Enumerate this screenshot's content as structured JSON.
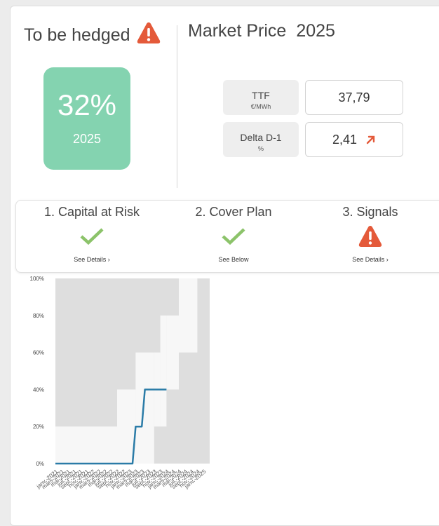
{
  "hedge": {
    "title": "To be hedged",
    "percent": "32%",
    "year": "2025"
  },
  "market": {
    "title": "Market Price",
    "year": "2025",
    "rows": [
      {
        "label": "TTF",
        "unit": "€/MWh",
        "value": "37,79"
      },
      {
        "label": "Delta D-1",
        "unit": "%",
        "value": "2,41",
        "trend": "up"
      }
    ]
  },
  "steps": [
    {
      "title": "1. Capital at Risk",
      "status": "ok",
      "link": "See Details",
      "chevron": "›"
    },
    {
      "title": "2. Cover Plan",
      "status": "ok",
      "link": "See Below"
    },
    {
      "title": "3. Signals",
      "status": "warning",
      "link": "See Details",
      "chevron": "›"
    }
  ],
  "colors": {
    "accent_green": "#84d3b0",
    "check_green": "#8cc36a",
    "warning_red": "#e45a3a",
    "line_blue": "#2a7ba7",
    "band_dark": "#dedede",
    "band_light": "#f7f7f7"
  },
  "chart_data": {
    "type": "area",
    "x": [
      "janv.-2021",
      "mars-2021",
      "mai-2021",
      "juil.-2021",
      "sept.-2021",
      "nov.-2021",
      "janv.-2022",
      "mars-2022",
      "mai-2022",
      "juil.-2022",
      "sept.-2022",
      "nov.-2022",
      "janv.-2023",
      "mars-2023",
      "mai-2023",
      "juil.-2023",
      "sept.-2023",
      "nov.-2023",
      "janv.-2024",
      "mars-2024",
      "mai-2024",
      "juil.-2024",
      "sept.-2024",
      "nov.-2024",
      "janv.-2025"
    ],
    "yticks": [
      "0%",
      "20%",
      "40%",
      "60%",
      "80%",
      "100%"
    ],
    "ylim": [
      0,
      100
    ],
    "xlim": [
      "janv.-2021",
      "mars-2025"
    ],
    "corridor_bands": [
      {
        "from": "janv.-2021",
        "to": "sept.-2022",
        "min": 0,
        "max": 20
      },
      {
        "from": "sept.-2022",
        "to": "mars-2023",
        "min": 0,
        "max": 40
      },
      {
        "from": "mars-2023",
        "to": "sept.-2023",
        "min": 0,
        "max": 60
      },
      {
        "from": "sept.-2023",
        "to": "nov.-2023",
        "min": 20,
        "max": 60
      },
      {
        "from": "nov.-2023",
        "to": "janv.-2024",
        "min": 20,
        "max": 80
      },
      {
        "from": "janv.-2024",
        "to": "mai-2024",
        "min": 40,
        "max": 80
      },
      {
        "from": "mai-2024",
        "to": "nov.-2024",
        "min": 60,
        "max": 100
      }
    ],
    "series": [
      {
        "points": [
          [
            "janv.-2021",
            0
          ],
          [
            "févr.-2023",
            0
          ],
          [
            "mars-2023",
            20
          ],
          [
            "avr.-2023",
            20
          ],
          [
            "mai-2023",
            20
          ],
          [
            "juin-2023",
            40
          ],
          [
            "janv.-2024",
            40
          ]
        ]
      }
    ]
  }
}
